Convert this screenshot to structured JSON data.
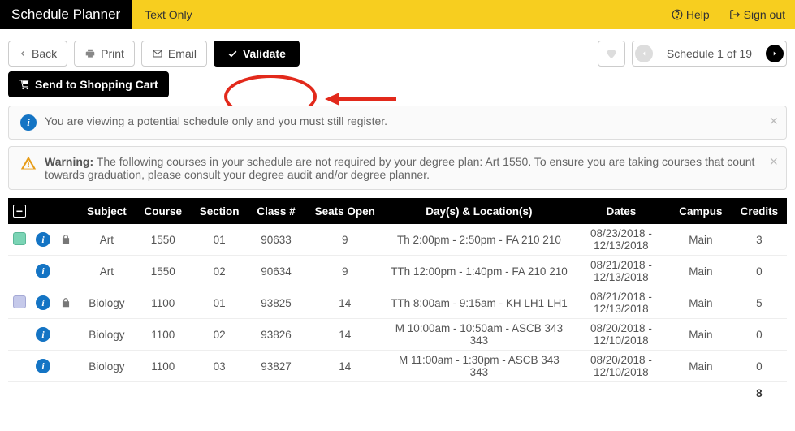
{
  "header": {
    "brand": "Schedule Planner",
    "text_only": "Text Only",
    "help": "Help",
    "sign_out": "Sign out"
  },
  "toolbar": {
    "back": "Back",
    "print": "Print",
    "email": "Email",
    "validate": "Validate",
    "send_cart": "Send to Shopping Cart",
    "schedule_label": "Schedule 1 of 19"
  },
  "alerts": {
    "info_text": "You are viewing a potential schedule only and you must still register.",
    "warn_label": "Warning:",
    "warn_text": " The following courses in your schedule are not required by your degree plan: Art 1550. To ensure you are taking courses that count towards graduation, please consult your degree audit and/or degree planner."
  },
  "table": {
    "headers": {
      "subject": "Subject",
      "course": "Course",
      "section": "Section",
      "class_no": "Class #",
      "seats": "Seats Open",
      "days": "Day(s) & Location(s)",
      "dates": "Dates",
      "campus": "Campus",
      "credits": "Credits"
    },
    "rows": [
      {
        "swatch": "teal",
        "lock": true,
        "subject": "Art",
        "course": "1550",
        "section": "01",
        "class_no": "90633",
        "seats": "9",
        "days": "Th 2:00pm - 2:50pm - FA 210 210",
        "dates": "08/23/2018 - 12/13/2018",
        "campus": "Main",
        "credits": "3"
      },
      {
        "swatch": "",
        "lock": false,
        "subject": "Art",
        "course": "1550",
        "section": "02",
        "class_no": "90634",
        "seats": "9",
        "days": "TTh 12:00pm - 1:40pm - FA 210 210",
        "dates": "08/21/2018 - 12/13/2018",
        "campus": "Main",
        "credits": "0"
      },
      {
        "swatch": "lav",
        "lock": true,
        "subject": "Biology",
        "course": "1100",
        "section": "01",
        "class_no": "93825",
        "seats": "14",
        "days": "TTh 8:00am - 9:15am - KH LH1 LH1",
        "dates": "08/21/2018 - 12/13/2018",
        "campus": "Main",
        "credits": "5"
      },
      {
        "swatch": "",
        "lock": false,
        "subject": "Biology",
        "course": "1100",
        "section": "02",
        "class_no": "93826",
        "seats": "14",
        "days": "M 10:00am - 10:50am - ASCB 343 343",
        "dates": "08/20/2018 - 12/10/2018",
        "campus": "Main",
        "credits": "0"
      },
      {
        "swatch": "",
        "lock": false,
        "subject": "Biology",
        "course": "1100",
        "section": "03",
        "class_no": "93827",
        "seats": "14",
        "days": "M 11:00am - 1:30pm - ASCB 343 343",
        "dates": "08/20/2018 - 12/10/2018",
        "campus": "Main",
        "credits": "0"
      }
    ],
    "total_credits": "8"
  }
}
